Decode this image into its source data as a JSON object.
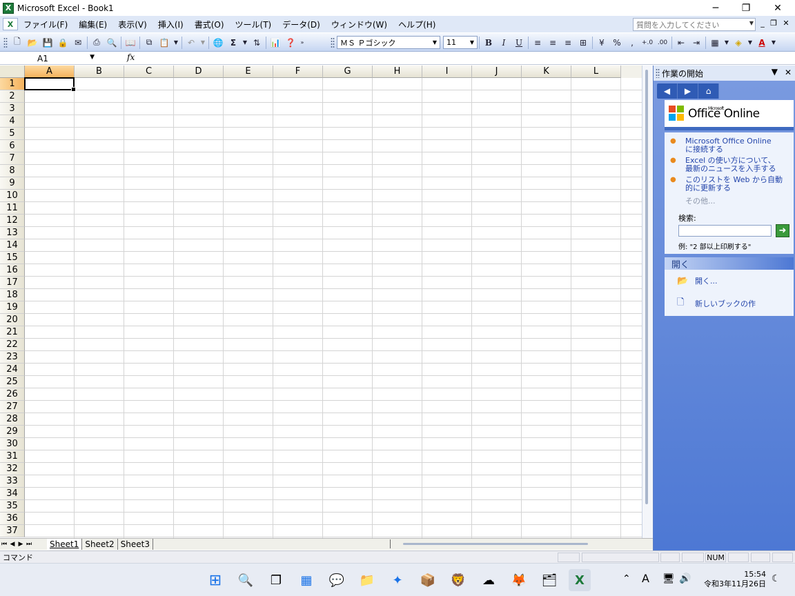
{
  "window": {
    "title": "Microsoft Excel - Book1",
    "icon": "excel-icon",
    "minimize": "─",
    "restore": "❐",
    "close": "✕"
  },
  "menu": {
    "items": [
      "ファイル(F)",
      "編集(E)",
      "表示(V)",
      "挿入(I)",
      "書式(O)",
      "ツール(T)",
      "データ(D)",
      "ウィンドウ(W)",
      "ヘルプ(H)"
    ],
    "help_placeholder": "質問を入力してください"
  },
  "toolbar": {
    "font": "ＭＳ Ｐゴシック",
    "size": "11"
  },
  "formula": {
    "namebox": "A1",
    "fx": "fx"
  },
  "grid": {
    "columns": [
      "A",
      "B",
      "C",
      "D",
      "E",
      "F",
      "G",
      "H",
      "I",
      "J",
      "K",
      "L"
    ],
    "rows": [
      "1",
      "2",
      "3",
      "4",
      "5",
      "6",
      "7",
      "8",
      "9",
      "10",
      "11",
      "12",
      "13",
      "14",
      "15",
      "16",
      "17",
      "18",
      "19",
      "20",
      "21",
      "22",
      "23",
      "24",
      "25",
      "26",
      "27",
      "28",
      "29",
      "30",
      "31",
      "32",
      "33",
      "34",
      "35",
      "36",
      "37"
    ]
  },
  "sheets": [
    "Sheet1",
    "Sheet2",
    "Sheet3"
  ],
  "status": {
    "text": "コマンド",
    "num": "NUM"
  },
  "taskpane": {
    "title": "作業の開始",
    "logo_small": "Microsoft",
    "logo": "Office Online",
    "links": [
      [
        "Microsoft Office Online",
        "に接続する"
      ],
      [
        "Excel の使い方について、",
        "最新のニュースを入手する"
      ],
      [
        "このリストを Web から自動",
        "的に更新する"
      ]
    ],
    "more": "その他...",
    "search_label": "検索:",
    "search_example": "例: \"2 部以上印刷する\"",
    "open_header": "開く",
    "open_items": [
      "開く...",
      "新しいブックの作"
    ]
  },
  "clock": {
    "time": "15:54",
    "date": "令和3年11月26日"
  },
  "colors": {
    "accent": "#4d78d4",
    "menubar": "#dfe8f7",
    "active_header": "#f5b25c"
  }
}
